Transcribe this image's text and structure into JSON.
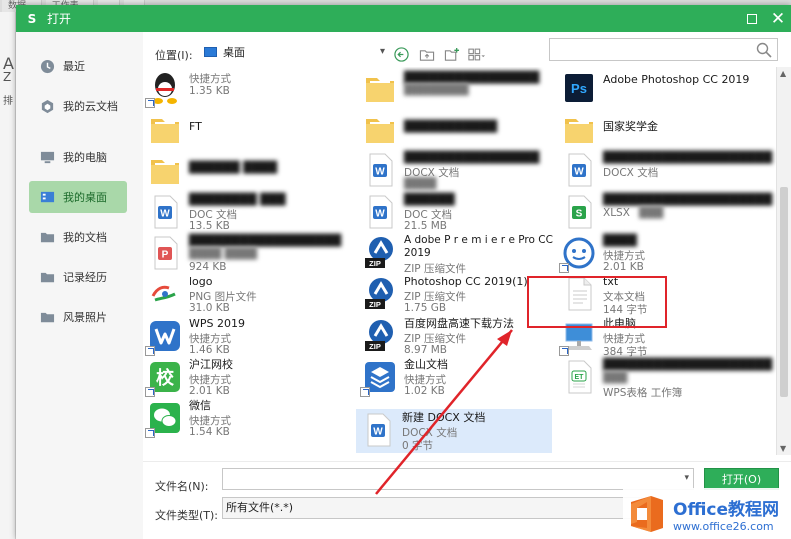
{
  "background": {
    "tabs": [
      "数据...",
      "工作表...",
      "...",
      "..."
    ]
  },
  "dialog": {
    "title": "打开",
    "logo_letter": "S"
  },
  "sidebar": {
    "items": [
      {
        "label": "最近",
        "icon": "clock-icon"
      },
      {
        "label": "我的云文档",
        "icon": "cloud-doc-icon"
      },
      {
        "label": "我的电脑",
        "icon": "monitor-icon"
      },
      {
        "label": "我的桌面",
        "icon": "desktop-icon",
        "active": true
      },
      {
        "label": "我的文档",
        "icon": "folder-icon"
      },
      {
        "label": "记录经历",
        "icon": "folder-icon"
      },
      {
        "label": "风景照片",
        "icon": "folder-icon"
      }
    ]
  },
  "toolbar": {
    "location_label": "位置(I):",
    "location_value": "桌面"
  },
  "files": {
    "col1": [
      {
        "name": "",
        "type": "快捷方式",
        "size": "1.35 KB",
        "icon": "qq-icon",
        "shortcut": true
      },
      {
        "name": "FT",
        "type": "",
        "size": "",
        "icon": "folder-icon"
      },
      {
        "name": "",
        "type": "",
        "size": "",
        "icon": "folder-icon"
      },
      {
        "name": "",
        "type": "DOC 文档",
        "size": "13.5 KB",
        "icon": "word-doc-icon"
      },
      {
        "name": "",
        "type": "",
        "size": "924 KB",
        "icon": "pdf-icon"
      },
      {
        "name": "logo",
        "type": "PNG 图片文件",
        "size": "31.0 KB",
        "icon": "image-icon"
      },
      {
        "name": "WPS 2019",
        "type": "快捷方式",
        "size": "1.46 KB",
        "icon": "wps-icon",
        "shortcut": true
      },
      {
        "name": "沪江网校",
        "type": "快捷方式",
        "size": "2.01 KB",
        "icon": "hujiang-icon",
        "shortcut": true
      },
      {
        "name": "微信",
        "type": "快捷方式",
        "size": "1.54 KB",
        "icon": "wechat-icon",
        "shortcut": true
      }
    ],
    "col2": [
      {
        "name": "",
        "type": "",
        "size": "",
        "icon": "folder-icon"
      },
      {
        "name": "",
        "type": "",
        "size": "",
        "icon": "folder-icon"
      },
      {
        "name": "",
        "type": "DOCX 文档",
        "size": "",
        "icon": "word-doc-icon"
      },
      {
        "name": "",
        "type": "DOC 文档",
        "size": "21.5 MB",
        "icon": "word-doc-icon"
      },
      {
        "name": "A dobe P r e m i e r e Pro CC 2019",
        "type": "ZIP 压缩文件",
        "size": "",
        "icon": "zip-icon"
      },
      {
        "name": "Photoshop CC 2019(1)",
        "type": "ZIP 压缩文件",
        "size": "1.75 GB",
        "icon": "zip-icon"
      },
      {
        "name": "百度网盘高速下载方法",
        "type": "ZIP 压缩文件",
        "size": "8.97 MB",
        "icon": "zip-icon"
      },
      {
        "name": "金山文档",
        "type": "快捷方式",
        "size": "1.02 KB",
        "icon": "kingsoft-docs-icon",
        "shortcut": true
      },
      {
        "name": "新建 DOCX 文档",
        "type": "DOCX 文档",
        "size": "0 字节",
        "icon": "word-doc-icon",
        "selected": true
      }
    ],
    "col3": [
      {
        "name": "Adobe Photoshop CC 2019",
        "type": "",
        "size": "",
        "icon": "photoshop-icon"
      },
      {
        "name": "国家奖学金",
        "type": "",
        "size": "",
        "icon": "folder-icon"
      },
      {
        "name": "",
        "type": "DOCX 文档",
        "size": "",
        "icon": "word-doc-icon"
      },
      {
        "name": "",
        "type": "XLSX",
        "size": "",
        "icon": "spreadsheet-icon"
      },
      {
        "name": "",
        "type": "快捷方式",
        "size": "2.01 KB",
        "icon": "app-shortcut-icon",
        "shortcut": true
      },
      {
        "name": "txt",
        "type": "文本文档",
        "size": "144 字节",
        "icon": "text-file-icon"
      },
      {
        "name": "此电脑",
        "type": "快捷方式",
        "size": "384 字节",
        "icon": "computer-icon",
        "shortcut": true
      },
      {
        "name": "",
        "type": "WPS表格 工作簿",
        "size": "",
        "icon": "et-sheet-icon"
      }
    ]
  },
  "bottom": {
    "filename_label": "文件名(N):",
    "filename_value": "",
    "open_label": "打开(O)",
    "filetype_label": "文件类型(T):",
    "filetype_value": "所有文件(*.*)"
  },
  "watermark": {
    "line1": "Office教程网",
    "line2": "www.office26.com"
  },
  "colors": {
    "accent": "#2eae59",
    "highlight": "#e0242a",
    "watermark": "#2d6fd2"
  }
}
